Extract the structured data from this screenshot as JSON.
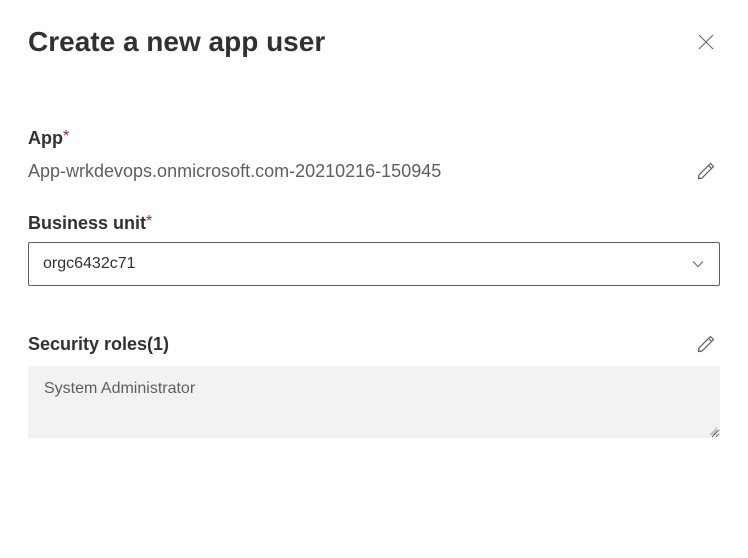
{
  "header": {
    "title": "Create a new app user"
  },
  "app": {
    "label": "App",
    "value": "App-wrkdevops.onmicrosoft.com-20210216-150945"
  },
  "businessUnit": {
    "label": "Business unit ",
    "value": "orgc6432c71"
  },
  "securityRoles": {
    "label": "Security roles(1)",
    "items": [
      "System Administrator"
    ]
  }
}
